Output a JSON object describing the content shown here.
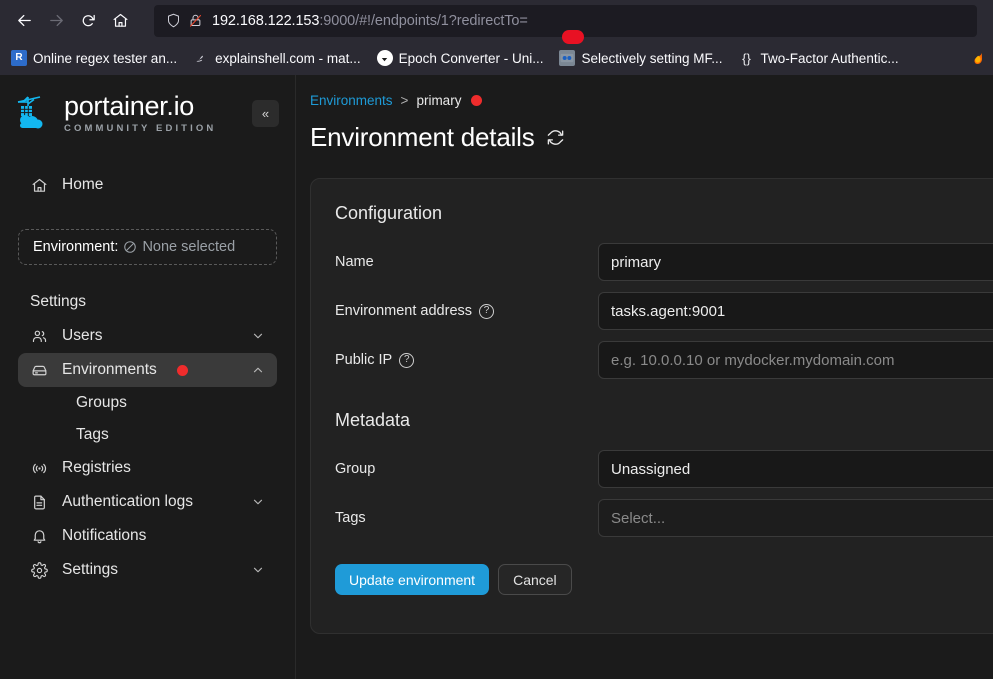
{
  "browser": {
    "nav": {
      "back": "back-arrow",
      "forward": "forward-arrow",
      "reload": "reload",
      "home": "home"
    },
    "url": {
      "host": "192.168.122.153",
      "rest": ":9000/#!/endpoints/1?redirectTo=",
      "shield_icon": "shield-icon",
      "lock_icon": "lock-slash-icon"
    },
    "bookmarks": [
      {
        "icon": "regex-icon",
        "icon_text": "R",
        "label": "Online regex tester an..."
      },
      {
        "icon": "shell-icon",
        "icon_text": "⌘",
        "label": "explainshell.com - mat..."
      },
      {
        "icon": "clock-icon",
        "icon_text": "▼",
        "label": "Epoch Converter - Uni..."
      },
      {
        "icon": "mfa-icon",
        "icon_text": "◉",
        "label": "Selectively setting MF..."
      },
      {
        "icon": "braces-icon",
        "icon_text": "{}",
        "label": "Two-Factor Authentic..."
      }
    ],
    "overflow_icon": "firefox-icon"
  },
  "sidebar": {
    "logo": {
      "title": "portainer.io",
      "subtitle": "COMMUNITY EDITION",
      "mark": "portainer-crane-logo"
    },
    "collapse_label": "«",
    "home": {
      "label": "Home",
      "icon": "home-icon"
    },
    "environment_selector": {
      "label": "Environment:",
      "value": "None selected",
      "icon": "no-selection-icon"
    },
    "settings_heading": "Settings",
    "items": [
      {
        "label": "Users",
        "icon": "users-icon",
        "chevron": "chevron-down",
        "expanded": false,
        "badge": false
      },
      {
        "label": "Environments",
        "icon": "environments-icon",
        "chevron": "chevron-up",
        "expanded": true,
        "badge": true,
        "active": true
      },
      {
        "label": "Registries",
        "icon": "registries-icon",
        "chevron": "",
        "expanded": false,
        "badge": false
      },
      {
        "label": "Authentication logs",
        "icon": "document-icon",
        "chevron": "chevron-down",
        "expanded": false,
        "badge": false
      },
      {
        "label": "Notifications",
        "icon": "bell-icon",
        "chevron": "",
        "expanded": false,
        "badge": false
      },
      {
        "label": "Settings",
        "icon": "gear-icon",
        "chevron": "chevron-down",
        "expanded": false,
        "badge": false
      }
    ],
    "sub_items": [
      {
        "label": "Groups"
      },
      {
        "label": "Tags"
      }
    ]
  },
  "main": {
    "breadcrumb": {
      "parent": "Environments",
      "separator": ">",
      "current": "primary"
    },
    "title": "Environment details",
    "refresh_icon": "refresh-icon",
    "configuration": {
      "heading": "Configuration",
      "fields": [
        {
          "label": "Name",
          "help": false,
          "value": "primary",
          "placeholder": "",
          "kind": "text"
        },
        {
          "label": "Environment address",
          "help": true,
          "value": "tasks.agent:9001",
          "placeholder": "",
          "kind": "text"
        },
        {
          "label": "Public IP",
          "help": true,
          "value": "",
          "placeholder": "e.g. 10.0.0.10 or mydocker.mydomain.com",
          "kind": "text"
        }
      ]
    },
    "metadata": {
      "heading": "Metadata",
      "fields": [
        {
          "label": "Group",
          "help": false,
          "value": "Unassigned",
          "placeholder": "",
          "kind": "select"
        },
        {
          "label": "Tags",
          "help": false,
          "value": "",
          "placeholder": "Select...",
          "kind": "tagselect"
        }
      ]
    },
    "buttons": {
      "submit": "Update environment",
      "cancel": "Cancel"
    }
  },
  "colors": {
    "accent_blue": "#1f9bd8",
    "link_blue": "#1e9bd7",
    "badge_red": "#ef2c2c",
    "logo_blue": "#13b7ef",
    "panel_bg": "#222222",
    "page_bg": "#1b1b1b"
  }
}
